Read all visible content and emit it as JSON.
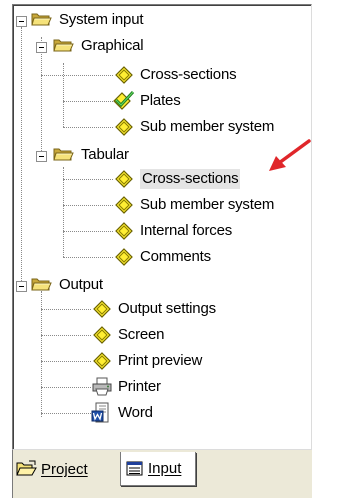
{
  "tree": {
    "system_input": {
      "label": "System input",
      "icon": "folder-open-icon"
    },
    "graphical": {
      "label": "Graphical",
      "icon": "folder-open-icon"
    },
    "graphical_items": [
      {
        "label": "Cross-sections",
        "icon": "diamond-icon"
      },
      {
        "label": "Plates",
        "icon": "checked-diamond-icon"
      },
      {
        "label": "Sub member system",
        "icon": "diamond-icon"
      }
    ],
    "tabular": {
      "label": "Tabular",
      "icon": "folder-open-icon"
    },
    "tabular_items": [
      {
        "label": "Cross-sections",
        "icon": "diamond-icon",
        "selected": true
      },
      {
        "label": "Sub member system",
        "icon": "diamond-icon"
      },
      {
        "label": "Internal forces",
        "icon": "diamond-icon"
      },
      {
        "label": "Comments",
        "icon": "diamond-icon"
      }
    ],
    "output": {
      "label": "Output",
      "icon": "folder-open-icon"
    },
    "output_items": [
      {
        "label": "Output settings",
        "icon": "diamond-icon"
      },
      {
        "label": "Screen",
        "icon": "diamond-icon"
      },
      {
        "label": "Print preview",
        "icon": "diamond-icon"
      },
      {
        "label": "Printer",
        "icon": "printer-icon"
      },
      {
        "label": "Word",
        "icon": "word-icon"
      }
    ]
  },
  "tabs": [
    {
      "label": "Project",
      "icon": "open-folder-icon",
      "active": false
    },
    {
      "label": "Input",
      "icon": "input-table-icon",
      "active": true
    }
  ],
  "colors": {
    "diamond_fill": "#ffee33",
    "folder": "#f5e27a",
    "arrow": "#e0262a",
    "selection": "#e4e4e4"
  }
}
